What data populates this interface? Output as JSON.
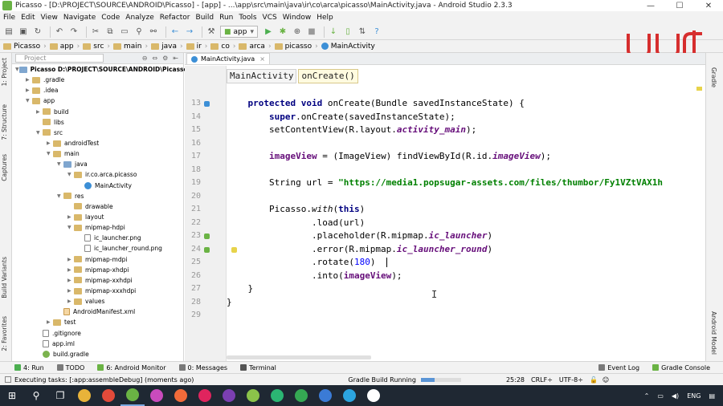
{
  "window": {
    "title": "Picasso - [D:\\PROJECT\\SOURCE\\ANDROID\\Picasso] - [app] - ...\\app\\src\\main\\java\\ir\\co\\arca\\picasso\\MainActivity.java - Android Studio 2.3.3",
    "minimize": "—",
    "maximize": "☐",
    "close": "✕"
  },
  "menu": [
    "File",
    "Edit",
    "View",
    "Navigate",
    "Code",
    "Analyze",
    "Refactor",
    "Build",
    "Run",
    "Tools",
    "VCS",
    "Window",
    "Help"
  ],
  "toolbar": {
    "run_config": "app",
    "icons": [
      "folder-open-icon",
      "save-icon",
      "sync-icon",
      "undo-icon",
      "redo-icon",
      "cut-icon",
      "copy-icon",
      "paste-icon",
      "find-icon",
      "replace-icon",
      "back-icon",
      "forward-icon",
      "build-icon",
      "run-icon",
      "debug-icon",
      "attach-icon",
      "stop-icon",
      "sdk-icon",
      "avd-icon",
      "help-icon"
    ]
  },
  "breadcrumb": [
    "Picasso",
    "app",
    "src",
    "main",
    "java",
    "ir",
    "co",
    "arca",
    "picasso",
    "MainActivity"
  ],
  "left_stripe": [
    "1: Project",
    "7: Structure",
    "Captures",
    "Build Variants",
    "2: Favorites"
  ],
  "right_stripe": [
    "Gradle",
    "Android Model"
  ],
  "project": {
    "view": "Project",
    "tree": [
      {
        "label": "Picasso D:\\PROJECT\\SOURCE\\ANDROID\\Picasso",
        "depth": 0,
        "kind": "folder-blue",
        "open": true
      },
      {
        "label": ".gradle",
        "depth": 1,
        "kind": "folder",
        "open": false
      },
      {
        "label": ".idea",
        "depth": 1,
        "kind": "folder",
        "open": false
      },
      {
        "label": "app",
        "depth": 1,
        "kind": "folder",
        "open": true
      },
      {
        "label": "build",
        "depth": 2,
        "kind": "folder",
        "open": false
      },
      {
        "label": "libs",
        "depth": 2,
        "kind": "folder",
        "open": null
      },
      {
        "label": "src",
        "depth": 2,
        "kind": "folder",
        "open": true
      },
      {
        "label": "androidTest",
        "depth": 3,
        "kind": "folder",
        "open": false
      },
      {
        "label": "main",
        "depth": 3,
        "kind": "folder",
        "open": true
      },
      {
        "label": "java",
        "depth": 4,
        "kind": "folder-blue",
        "open": true
      },
      {
        "label": "ir.co.arca.picasso",
        "depth": 5,
        "kind": "folder",
        "open": true
      },
      {
        "label": "MainActivity",
        "depth": 6,
        "kind": "class",
        "open": null
      },
      {
        "label": "res",
        "depth": 4,
        "kind": "folder",
        "open": true
      },
      {
        "label": "drawable",
        "depth": 5,
        "kind": "folder",
        "open": null
      },
      {
        "label": "layout",
        "depth": 5,
        "kind": "folder",
        "open": false
      },
      {
        "label": "mipmap-hdpi",
        "depth": 5,
        "kind": "folder",
        "open": true
      },
      {
        "label": "ic_launcher.png",
        "depth": 6,
        "kind": "file",
        "open": null
      },
      {
        "label": "ic_launcher_round.png",
        "depth": 6,
        "kind": "file",
        "open": null
      },
      {
        "label": "mipmap-mdpi",
        "depth": 5,
        "kind": "folder",
        "open": false
      },
      {
        "label": "mipmap-xhdpi",
        "depth": 5,
        "kind": "folder",
        "open": false
      },
      {
        "label": "mipmap-xxhdpi",
        "depth": 5,
        "kind": "folder",
        "open": false
      },
      {
        "label": "mipmap-xxxhdpi",
        "depth": 5,
        "kind": "folder",
        "open": false
      },
      {
        "label": "values",
        "depth": 5,
        "kind": "folder",
        "open": false
      },
      {
        "label": "AndroidManifest.xml",
        "depth": 4,
        "kind": "xml",
        "open": null
      },
      {
        "label": "test",
        "depth": 3,
        "kind": "folder",
        "open": false
      },
      {
        "label": ".gitignore",
        "depth": 2,
        "kind": "file",
        "open": null
      },
      {
        "label": "app.iml",
        "depth": 2,
        "kind": "file",
        "open": null
      },
      {
        "label": "build.gradle",
        "depth": 2,
        "kind": "gradle",
        "open": null
      }
    ]
  },
  "editor": {
    "tab": "MainActivity.java",
    "tab_close": "×",
    "crumb_class": "MainActivity",
    "crumb_method": "onCreate()",
    "lines": [
      {
        "n": "13",
        "segs": [
          [
            "    ",
            ""
          ],
          [
            "protected void ",
            "kw"
          ],
          [
            "onCreate(Bundle savedInstanceState) {",
            ""
          ]
        ]
      },
      {
        "n": "14",
        "segs": [
          [
            "        ",
            ""
          ],
          [
            "super",
            "kw"
          ],
          [
            ".onCreate(savedInstanceState);",
            ""
          ]
        ]
      },
      {
        "n": "15",
        "segs": [
          [
            "        setContentView(R.layout.",
            ""
          ],
          [
            "activity_main",
            "fld"
          ],
          [
            ");",
            ""
          ]
        ]
      },
      {
        "n": "16",
        "segs": []
      },
      {
        "n": "17",
        "segs": [
          [
            "        ",
            ""
          ],
          [
            "imageView",
            "fn"
          ],
          [
            " = (ImageView) findViewById(R.id.",
            ""
          ],
          [
            "imageView",
            "fld"
          ],
          [
            ");",
            ""
          ]
        ]
      },
      {
        "n": "18",
        "segs": []
      },
      {
        "n": "19",
        "segs": [
          [
            "        String url = ",
            ""
          ],
          [
            "\"https://media1.popsugar-assets.com/files/thumbor/Fy1VZtVAX1h",
            "str"
          ]
        ]
      },
      {
        "n": "20",
        "segs": []
      },
      {
        "n": "21",
        "segs": [
          [
            "        Picasso.",
            ""
          ],
          [
            "with",
            "it"
          ],
          [
            "(",
            ""
          ],
          [
            "this",
            "kw"
          ],
          [
            ")",
            ""
          ]
        ]
      },
      {
        "n": "22",
        "segs": [
          [
            "                .load(url)",
            ""
          ]
        ]
      },
      {
        "n": "23",
        "segs": [
          [
            "                .placeholder(R.mipmap.",
            ""
          ],
          [
            "ic_launcher",
            "fld"
          ],
          [
            ")",
            ""
          ]
        ]
      },
      {
        "n": "24",
        "segs": [
          [
            "                .error(R.mipmap.",
            ""
          ],
          [
            "ic_launcher_round",
            "fld"
          ],
          [
            ")",
            ""
          ]
        ]
      },
      {
        "n": "25",
        "segs": [
          [
            "                .rotate(",
            ""
          ],
          [
            "180",
            "num"
          ],
          [
            ")",
            ""
          ]
        ]
      },
      {
        "n": "26",
        "segs": [
          [
            "                .into(",
            ""
          ],
          [
            "imageView",
            "fn"
          ],
          [
            ");",
            ""
          ]
        ]
      },
      {
        "n": "27",
        "segs": [
          [
            "    }",
            ""
          ]
        ]
      },
      {
        "n": "28",
        "segs": [
          [
            "}",
            ""
          ]
        ]
      },
      {
        "n": "29",
        "segs": []
      }
    ]
  },
  "bottom_tabs": [
    {
      "label": "4: Run",
      "color": "#4caf50"
    },
    {
      "label": "TODO",
      "color": "#7a7a7a"
    },
    {
      "label": "6: Android Monitor",
      "color": "#6ab344"
    },
    {
      "label": "0: Messages",
      "color": "#7a7a7a"
    },
    {
      "label": "Terminal",
      "color": "#555555"
    }
  ],
  "bottom_right_tabs": [
    {
      "label": "Event Log",
      "color": "#7a7a7a"
    },
    {
      "label": "Gradle Console",
      "color": "#6ab344"
    }
  ],
  "status": {
    "left": "Executing tasks: [:app:assembleDebug] (moments ago)",
    "build": "Gradle Build Running",
    "build_progress": 0.35,
    "position": "25:28",
    "line_sep": "CRLF÷",
    "encoding": "UTF-8÷"
  },
  "taskbar": {
    "apps": [
      {
        "name": "windows-start-icon",
        "glyph": "⊞",
        "color": ""
      },
      {
        "name": "search-icon",
        "glyph": "⚲",
        "color": ""
      },
      {
        "name": "task-view-icon",
        "glyph": "❐",
        "color": ""
      },
      {
        "name": "file-explorer-icon",
        "glyph": "",
        "color": "#e8b33a"
      },
      {
        "name": "chrome-icon",
        "glyph": "",
        "color": "#e34a3a"
      },
      {
        "name": "android-studio-icon",
        "glyph": "",
        "color": "#6ab344"
      },
      {
        "name": "intellij-icon",
        "glyph": "",
        "color": "#c94bbd"
      },
      {
        "name": "postman-icon",
        "glyph": "",
        "color": "#f26b3a"
      },
      {
        "name": "app-oo-icon",
        "glyph": "",
        "color": "#e0245e"
      },
      {
        "name": "onenote-icon",
        "glyph": "",
        "color": "#7b3fb2"
      },
      {
        "name": "app-green-icon",
        "glyph": "",
        "color": "#8bc34a"
      },
      {
        "name": "edge-icon",
        "glyph": "",
        "color": "#2bb673"
      },
      {
        "name": "app-green2-icon",
        "glyph": "",
        "color": "#35a853"
      },
      {
        "name": "app-blue-icon",
        "glyph": "",
        "color": "#3b7bd6"
      },
      {
        "name": "telegram-icon",
        "glyph": "",
        "color": "#2ca5e0"
      },
      {
        "name": "app-oo2-icon",
        "glyph": "",
        "color": "#ffffff"
      }
    ],
    "lang": "ENG"
  },
  "colors": {
    "keyword": "#000080",
    "string": "#008000",
    "field": "#660e7a",
    "number": "#0000ff",
    "logo_red": "#d62e2e"
  }
}
